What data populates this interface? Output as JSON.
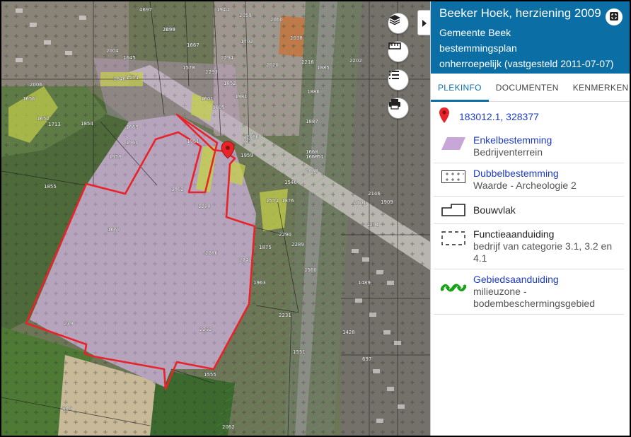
{
  "plan": {
    "title": "Beeker Hoek, herziening 2009",
    "municipality": "Gemeente Beek",
    "type": "bestemmingsplan",
    "status": "onherroepelijk (vastgesteld 2011-07-07)"
  },
  "tabs": [
    {
      "label": "PLEKINFO",
      "active": true
    },
    {
      "label": "DOCUMENTEN",
      "active": false
    },
    {
      "label": "KENMERKEN",
      "active": false
    }
  ],
  "location": {
    "coordinates": "183012.1, 328377",
    "icon": "map-pin-icon"
  },
  "legend": [
    {
      "title": "Enkelbestemming",
      "subtitle": "Bedrijventerrein",
      "link": true,
      "icon": "purple-parallelogram-icon"
    },
    {
      "title": "Dubbelbestemming",
      "subtitle": "Waarde - Archeologie 2",
      "link": true,
      "icon": "cross-grid-icon"
    },
    {
      "title": "Bouwvlak",
      "subtitle": "",
      "link": false,
      "icon": "building-outline-icon"
    },
    {
      "title": "Functieaanduiding",
      "subtitle": "bedrijf van categorie 3.1, 3.2 en 4.1",
      "link": false,
      "icon": "dashed-rectangle-icon"
    },
    {
      "title": "Gebiedsaanduiding",
      "subtitle": "milieuzone - bodembeschermingsgebied",
      "link": true,
      "icon": "green-zigzag-icon"
    }
  ],
  "map_controls": [
    {
      "name": "layers-button",
      "icon": "layers-icon"
    },
    {
      "name": "measure-button",
      "icon": "ruler-icon"
    },
    {
      "name": "legend-button",
      "icon": "list-icon"
    },
    {
      "name": "print-button",
      "icon": "printer-icon"
    }
  ],
  "map_labels": [
    "4697",
    "1666",
    "2299",
    "1944",
    "2059",
    "1667",
    "2060",
    "2038",
    "2004",
    "1645",
    "1578",
    "2293",
    "2294",
    "1702",
    "2020",
    "2202",
    "2216",
    "1885",
    "1646",
    "1574",
    "1852",
    "1886",
    "1959",
    "1601",
    "1605",
    "1981",
    "1887",
    "1651",
    "1713",
    "1854",
    "1669",
    "1960",
    "1961",
    "1959",
    "2086",
    "1669",
    "2088",
    "683",
    "1962",
    "1288",
    "1546",
    "2146",
    "1909",
    "1574",
    "1876",
    "2289",
    "2290",
    "2201",
    "1855",
    "1660",
    "2286",
    "2341",
    "1875",
    "1560",
    "1963",
    "239",
    "2232",
    "2231",
    "1555",
    "1551",
    "896",
    "2062",
    "1428",
    "697",
    "1489",
    "4291",
    "2006",
    "1656",
    "1652",
    "1668"
  ],
  "colors": {
    "header_bg": "#0b6ea5",
    "accent": "#0b6ea5",
    "link": "#1f3bc3",
    "plan_boundary": "#e8232a",
    "bedrijventerrein": "#c8a6d8"
  }
}
